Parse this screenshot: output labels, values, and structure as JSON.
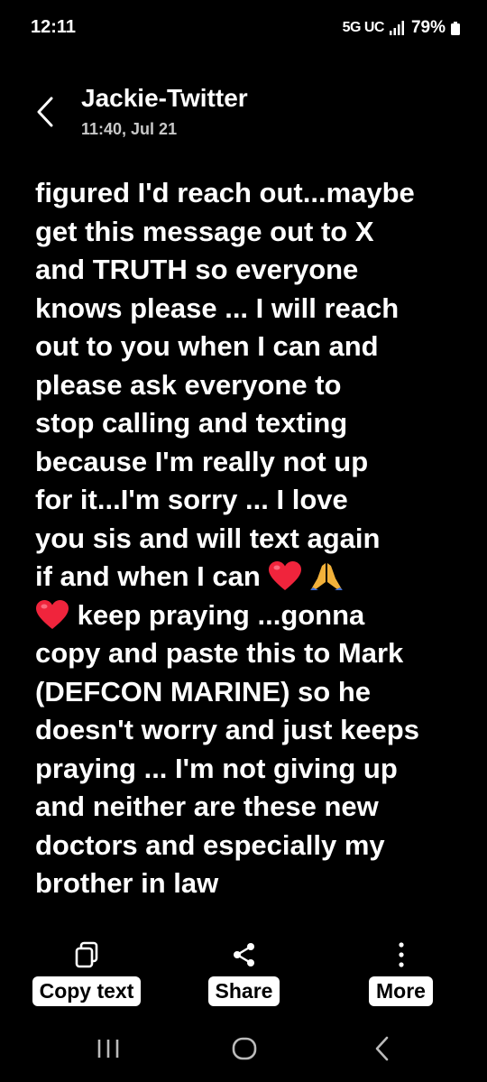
{
  "status_bar": {
    "time": "12:11",
    "network": "5G UC",
    "battery": "79%"
  },
  "header": {
    "contact_name": "Jackie-Twitter",
    "timestamp": "11:40, Jul 21"
  },
  "message": {
    "lines": [
      "figured I'd reach out...maybe",
      "get this message out to X",
      "and TRUTH so everyone",
      "knows please ... I will reach",
      "out to you when I can and",
      "please ask everyone to",
      "stop calling and texting",
      "because I'm really not up",
      "for it...I'm sorry ... I love",
      "you sis and will text again",
      "if and when I can",
      "keep praying ...gonna",
      "copy and paste this to Mark",
      "(DEFCON MARINE) so he",
      "doesn't worry and just keeps",
      "praying ... I'm not giving up",
      "and neither are these new",
      "doctors and especially my",
      "brother in law"
    ],
    "emoji_after_line_11": [
      "heart-emoji",
      "praying-hands-emoji"
    ],
    "emoji_before_line_12": [
      "heart-emoji"
    ]
  },
  "actions": {
    "copy": {
      "label": "Copy text",
      "icon": "copy-icon"
    },
    "share": {
      "label": "Share",
      "icon": "share-icon"
    },
    "more": {
      "label": "More",
      "icon": "more-vertical-icon"
    }
  },
  "nav": {
    "recents": "recents-icon",
    "home": "home-icon",
    "back": "back-icon"
  },
  "colors": {
    "background": "#000000",
    "text": "#ffffff",
    "subtext": "#c8c8c8",
    "heart": "#f0243c"
  }
}
